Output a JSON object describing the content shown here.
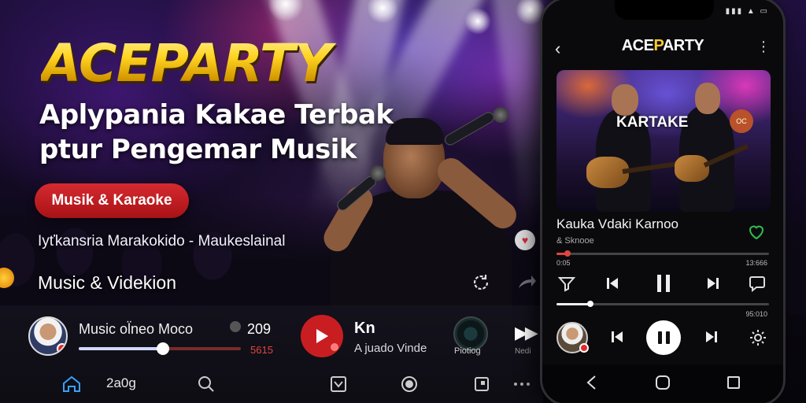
{
  "promo": {
    "brand": "ACEPARTY",
    "headline_line1": "Aplypania Kakae Terbak",
    "headline_line2": "ptur Pengemar Musik",
    "category_pill": "Musik & Karaoke",
    "subline": "Ιyťkansria Marakokido - Maukeslainal",
    "section_title": "Music & Videkion"
  },
  "bottom_bar": {
    "track_title": "Music ol̈neo Moco",
    "count": "209",
    "time": "5615",
    "progress": 0.52,
    "next_title": "Kn",
    "next_subtitle": "A juado Vinde",
    "photo_label": "Piotiog",
    "skip_label": "Nedi",
    "nav_label": "2a0g",
    "nav_icons": [
      "home-icon",
      "search-icon",
      "check-box-icon",
      "record-icon",
      "stop-square-icon",
      "more-dots-icon"
    ]
  },
  "phone": {
    "title_prefix": "ACE",
    "title_accent": "P",
    "title_suffix": "ARTY",
    "album_label": "KARTAKE",
    "album_button": "OC",
    "song_title": "Kauka Vdaki Karnoo",
    "artist": "& Sknooe",
    "elapsed": "0:05",
    "duration": "13:666",
    "progress_top": 0.05,
    "progress_bottom": 0.16,
    "duration_bottom": "95:010",
    "colors": {
      "accent": "#ffcc2a",
      "heart": "#2fbf4f",
      "progress": "#e0463f"
    }
  },
  "colors": {
    "brand_red": "#c81e22",
    "brand_gold": "#ffd320"
  }
}
